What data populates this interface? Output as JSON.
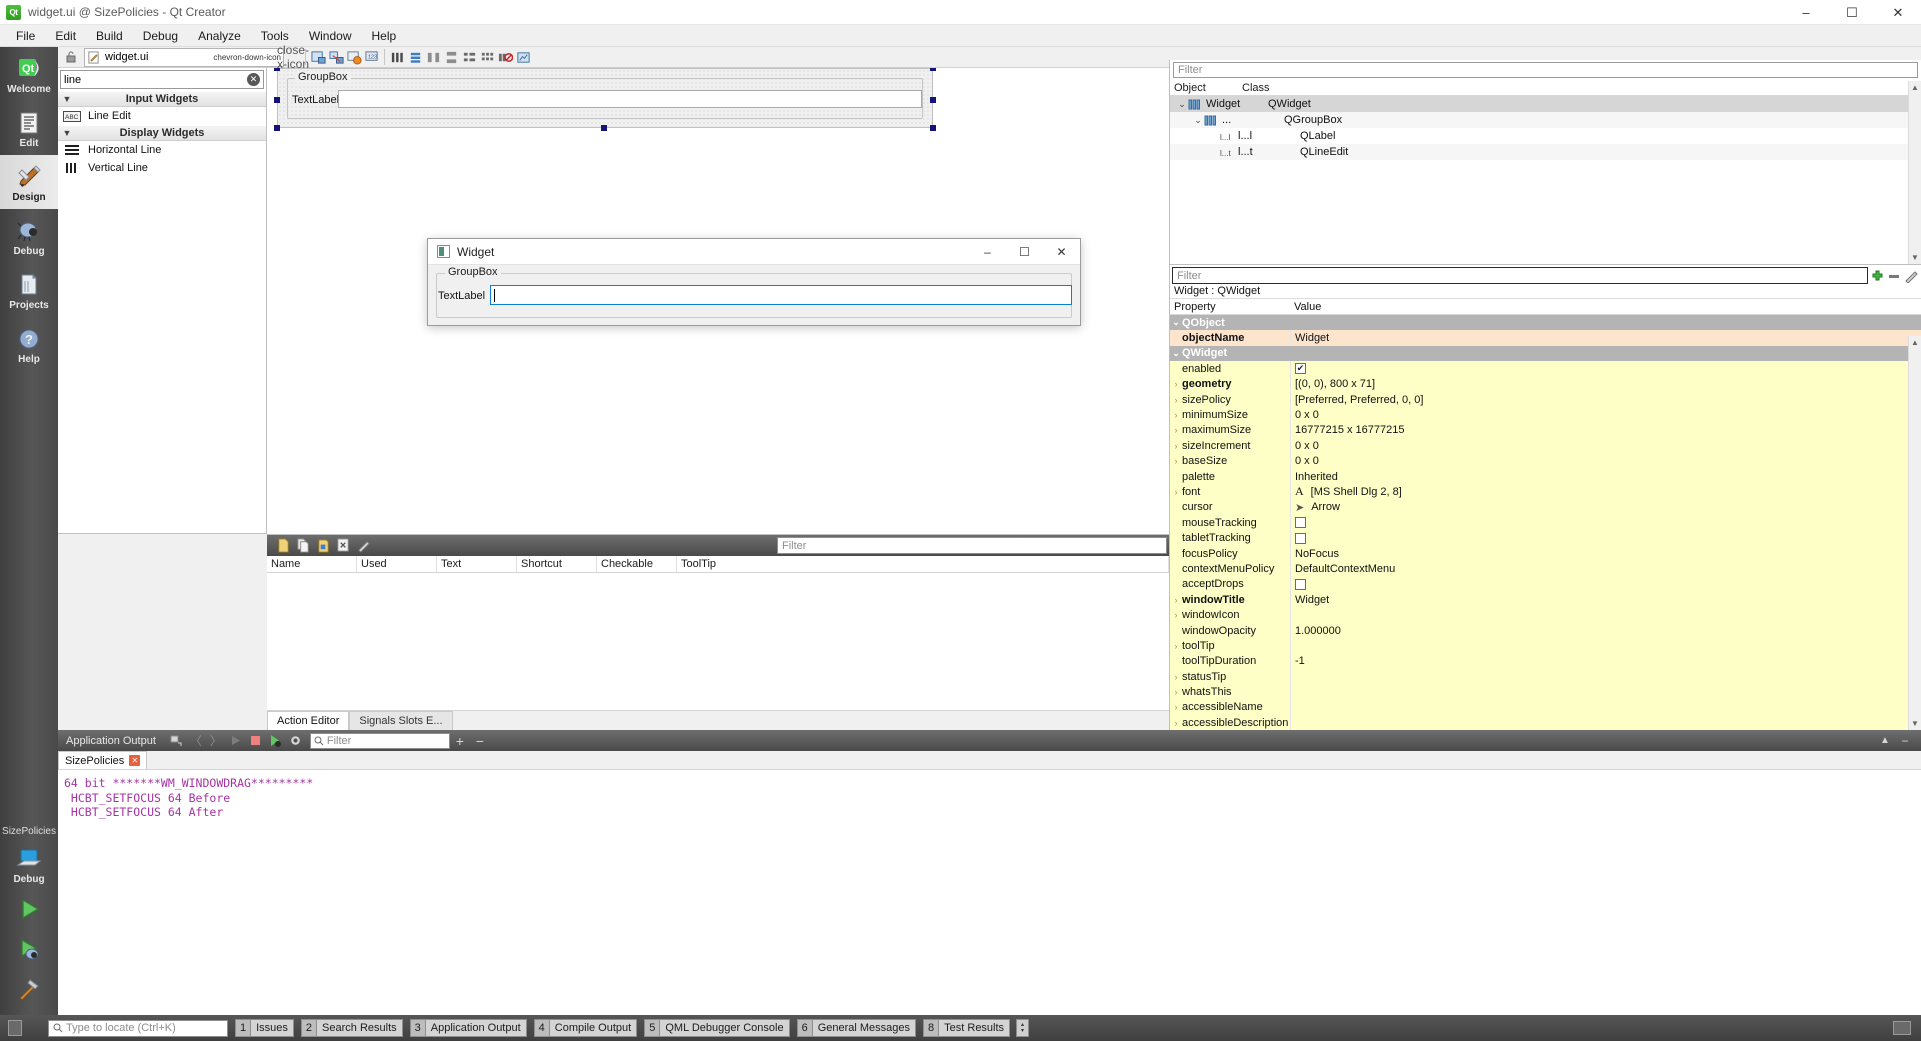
{
  "window": {
    "title": "widget.ui @ SizePolicies - Qt Creator",
    "logo": "qt-logo",
    "minimize": "–",
    "maximize": "☐",
    "close": "✕"
  },
  "menubar": {
    "items": [
      "File",
      "Edit",
      "Build",
      "Debug",
      "Analyze",
      "Tools",
      "Window",
      "Help"
    ]
  },
  "modebar": {
    "items": [
      {
        "label": "Welcome",
        "icon": "qt-welcome-icon",
        "active": false
      },
      {
        "label": "Edit",
        "icon": "document-edit-icon",
        "active": false
      },
      {
        "label": "Design",
        "icon": "design-pencil-icon",
        "active": true
      },
      {
        "label": "Debug",
        "icon": "debug-bug-icon",
        "active": false
      },
      {
        "label": "Projects",
        "icon": "projects-folder-icon",
        "active": false
      },
      {
        "label": "Help",
        "icon": "help-question-icon",
        "active": false
      }
    ],
    "project_name": "SizePolicies",
    "kit_label": "Debug",
    "kit_icon": "computer-icon",
    "run_icon": "run-play-icon",
    "debug_icon": "run-debug-icon",
    "build_icon": "build-hammer-icon"
  },
  "doc_toolbar": {
    "file_name": "widget.ui",
    "file_icon": "ui-file-icon",
    "dropdown_icon": "chevron-down-icon",
    "close_icon": "close-x-icon",
    "lock_icon": "lock-icon",
    "tools": [
      "edit-widgets-icon",
      "edit-signals-icon",
      "edit-buddies-icon",
      "edit-tab-order-icon",
      "layout-horizontal-icon",
      "layout-vertical-icon",
      "layout-splitter-h-icon",
      "layout-splitter-v-icon",
      "layout-form-icon",
      "layout-grid-icon",
      "break-layout-icon",
      "adjust-size-icon"
    ]
  },
  "widget_box": {
    "filter_value": "line",
    "filter_placeholder": "Filter",
    "clear_icon": "clear-circle-icon",
    "categories": [
      {
        "name": "Input Widgets",
        "expanded": true,
        "items": [
          {
            "label": "Line Edit",
            "icon": "line-edit-icon"
          }
        ]
      },
      {
        "name": "Display Widgets",
        "expanded": true,
        "items": [
          {
            "label": "Horizontal Line",
            "icon": "horizontal-line-icon"
          },
          {
            "label": "Vertical Line",
            "icon": "vertical-line-icon"
          }
        ]
      }
    ]
  },
  "form_editor": {
    "group_box_title": "GroupBox",
    "label_text": "TextLabel",
    "line_edit_value": ""
  },
  "preview_dialog": {
    "title": "Widget",
    "icon": "widget-window-icon",
    "minimize": "–",
    "maximize": "☐",
    "close": "✕",
    "group_box_title": "GroupBox",
    "label_text": "TextLabel",
    "line_edit_value": ""
  },
  "action_editor": {
    "toolbar_icons": [
      "new-action-icon",
      "copy-action-icon",
      "paste-action-icon",
      "delete-action-icon",
      "configure-wrench-icon"
    ],
    "filter_placeholder": "Filter",
    "columns": [
      "Name",
      "Used",
      "Text",
      "Shortcut",
      "Checkable",
      "ToolTip"
    ],
    "rows": [],
    "tabs": [
      {
        "label": "Action Editor",
        "selected": true
      },
      {
        "label": "Signals  Slots E...",
        "selected": false
      }
    ]
  },
  "object_inspector": {
    "filter_placeholder": "Filter",
    "columns": [
      "Object",
      "Class"
    ],
    "rows": [
      {
        "indent": 0,
        "expander": "⌄",
        "icon": "widget-icon",
        "object": "Widget",
        "cls": "QWidget",
        "selected": true
      },
      {
        "indent": 1,
        "expander": "⌄",
        "icon": "groupbox-icon",
        "object": "...",
        "cls": "QGroupBox",
        "selected": false
      },
      {
        "indent": 2,
        "expander": "",
        "icon": "label-icon",
        "object": "l...l",
        "cls": "QLabel",
        "selected": false
      },
      {
        "indent": 2,
        "expander": "",
        "icon": "lineedit-icon",
        "object": "l...t",
        "cls": "QLineEdit",
        "selected": false
      }
    ],
    "scroll_up_icon": "chevron-up-icon",
    "scroll_down_icon": "chevron-down-icon"
  },
  "property_editor": {
    "filter_placeholder": "Filter",
    "add_icon": "add-plus-icon",
    "remove_icon": "remove-minus-icon",
    "config_icon": "configure-wrench-icon",
    "subject": "Widget : QWidget",
    "columns": [
      "Property",
      "Value"
    ],
    "rows": [
      {
        "kind": "group",
        "expander": "⌄",
        "name": "QObject",
        "value": ""
      },
      {
        "kind": "peach",
        "expander": "",
        "name": "objectName",
        "bold": true,
        "value": "Widget"
      },
      {
        "kind": "group",
        "expander": "⌄",
        "name": "QWidget",
        "value": ""
      },
      {
        "kind": "yellow",
        "expander": "",
        "name": "enabled",
        "value": "",
        "value_type": "checkbox-checked"
      },
      {
        "kind": "yellow",
        "expander": "›",
        "name": "geometry",
        "bold": true,
        "value": "[(0, 0), 800 x 71]"
      },
      {
        "kind": "yellow",
        "expander": "›",
        "name": "sizePolicy",
        "value": "[Preferred, Preferred, 0, 0]"
      },
      {
        "kind": "yellow",
        "expander": "›",
        "name": "minimumSize",
        "value": "0 x 0"
      },
      {
        "kind": "yellow",
        "expander": "›",
        "name": "maximumSize",
        "value": "16777215 x 16777215"
      },
      {
        "kind": "yellow",
        "expander": "›",
        "name": "sizeIncrement",
        "value": "0 x 0"
      },
      {
        "kind": "yellow",
        "expander": "›",
        "name": "baseSize",
        "value": "0 x 0"
      },
      {
        "kind": "yellow",
        "expander": "",
        "name": "palette",
        "value": "Inherited"
      },
      {
        "kind": "yellow",
        "expander": "›",
        "name": "font",
        "value": "[MS Shell Dlg 2, 8]",
        "value_type": "font-icon"
      },
      {
        "kind": "yellow",
        "expander": "",
        "name": "cursor",
        "value": "Arrow",
        "value_type": "cursor-icon"
      },
      {
        "kind": "yellow",
        "expander": "",
        "name": "mouseTracking",
        "value": "",
        "value_type": "checkbox-unchecked"
      },
      {
        "kind": "yellow",
        "expander": "",
        "name": "tabletTracking",
        "value": "",
        "value_type": "checkbox-unchecked"
      },
      {
        "kind": "yellow",
        "expander": "",
        "name": "focusPolicy",
        "value": "NoFocus"
      },
      {
        "kind": "yellow",
        "expander": "",
        "name": "contextMenuPolicy",
        "value": "DefaultContextMenu"
      },
      {
        "kind": "yellow",
        "expander": "",
        "name": "acceptDrops",
        "value": "",
        "value_type": "checkbox-unchecked"
      },
      {
        "kind": "yellow",
        "expander": "›",
        "name": "windowTitle",
        "bold": true,
        "value": "Widget"
      },
      {
        "kind": "yellow",
        "expander": "›",
        "name": "windowIcon",
        "value": ""
      },
      {
        "kind": "yellow",
        "expander": "",
        "name": "windowOpacity",
        "value": "1.000000"
      },
      {
        "kind": "yellow",
        "expander": "›",
        "name": "toolTip",
        "value": ""
      },
      {
        "kind": "yellow",
        "expander": "",
        "name": "toolTipDuration",
        "value": "-1"
      },
      {
        "kind": "yellow",
        "expander": "›",
        "name": "statusTip",
        "value": ""
      },
      {
        "kind": "yellow",
        "expander": "›",
        "name": "whatsThis",
        "value": ""
      },
      {
        "kind": "yellow",
        "expander": "›",
        "name": "accessibleName",
        "value": ""
      },
      {
        "kind": "yellow",
        "expander": "›",
        "name": "accessibleDescription",
        "value": ""
      }
    ]
  },
  "application_output": {
    "title": "Application Output",
    "filter_placeholder": "Filter",
    "toolbar_icons": [
      "attach-debugger-icon",
      "prev-item-icon",
      "next-item-icon",
      "rerun-icon",
      "stop-icon",
      "run-with-debug-icon",
      "settings-gear-icon"
    ],
    "zoom_in_icon": "plus-icon",
    "zoom_out_icon": "minus-icon",
    "tab_label": "SizePolicies",
    "tab_close_icon": "close-x-icon",
    "lines": [
      "64 bit *******WM_WINDOWDRAG*********",
      " HCBT_SETFOCUS 64 Before",
      " HCBT_SETFOCUS 64 After"
    ],
    "maximize_icon": "chevron-up-icon",
    "minimize_icon": "minus-icon"
  },
  "status_bar": {
    "sidebar_toggle_icon": "sidebar-toggle-icon",
    "locator_placeholder": "Type to locate (Ctrl+K)",
    "search_icon": "search-icon",
    "panes": [
      {
        "num": "1",
        "label": "Issues"
      },
      {
        "num": "2",
        "label": "Search Results"
      },
      {
        "num": "3",
        "label": "Application Output"
      },
      {
        "num": "4",
        "label": "Compile Output"
      },
      {
        "num": "5",
        "label": "QML Debugger Console"
      },
      {
        "num": "6",
        "label": "General Messages"
      },
      {
        "num": "8",
        "label": "Test Results"
      }
    ],
    "spin_up": "▴",
    "spin_down": "▾",
    "progress_icon": "progress-details-icon"
  },
  "colors": {
    "accent": "#0a7fd4",
    "selection": "#d6d6d6",
    "property_yellow": "#feffc6",
    "property_peach": "#fde4cd",
    "group_gray": "#b4b4b4",
    "output_text": "#a733a7",
    "mode_bar": "#565656"
  }
}
